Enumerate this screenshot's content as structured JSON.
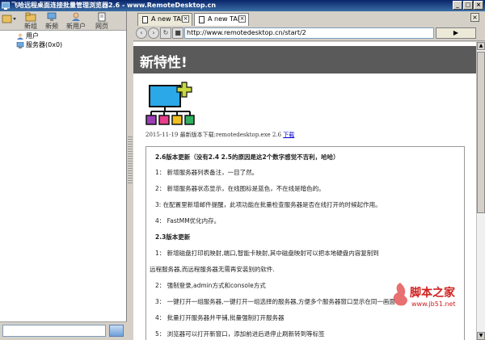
{
  "window": {
    "title": "飞哈远程桌面连接批量管理浏览器2.6 - www.RemoteDesktop.cn",
    "buttons": [
      "_",
      "□",
      "×"
    ]
  },
  "left_toolbar": [
    {
      "label": "新组",
      "icon": "new-group-icon"
    },
    {
      "label": "新频",
      "icon": "new-channel-icon"
    },
    {
      "label": "新用户",
      "icon": "new-user-icon"
    },
    {
      "label": "网页",
      "icon": "webpage-icon"
    }
  ],
  "tree": [
    {
      "label": "用户",
      "icon": "user-icon"
    },
    {
      "label": "服务器(0x0)",
      "icon": "server-icon"
    }
  ],
  "tabs": [
    {
      "label": "A new TAB",
      "close": "×"
    },
    {
      "label": "A new TAB",
      "close": "×"
    }
  ],
  "close_all": "×",
  "nav": {
    "address": "http://www.remotedesktop.cn/start/2",
    "back": "‹",
    "forward": "›",
    "refresh": "↻",
    "stop": "■",
    "go": "▶"
  },
  "page": {
    "title": "新特性!",
    "download_text": "2015-11-19 最新版本下载:remotedesktop.exe 2.6",
    "download_link": "下载",
    "notes": [
      {
        "text": "2.6版本更新（没有2.4 2.5的原因是这2个数字感觉不吉利，哈哈）",
        "bold": true
      },
      {
        "text": "1： 新增服务器列表备注，一目了然。",
        "bold": false
      },
      {
        "text": "2： 新增服务器状态显示，在线图标是蓝色，不在线是暗色的。",
        "bold": false
      },
      {
        "text": "3: 在配置里新增邮件提醒，此项功能在批量检查服务器是否在线打开的时候起作用。",
        "bold": false
      },
      {
        "text": "4： FastMM优化内存。",
        "bold": false
      },
      {
        "text": "2.3版本更新",
        "bold": true
      },
      {
        "text": "1： 新增磁盘打印机映射,端口,智能卡映射,其中磁盘映射可以把本地硬盘内容复制到",
        "bold": false
      },
      {
        "text": "远程服务器,而远程服务器无需再安装别的软件.",
        "bold": false
      },
      {
        "text": "2： 强制登录,admin方式和console方式",
        "bold": false
      },
      {
        "text": "3： 一键打开一组服务器,一键打开一组选择的服务器,方便多个服务器窗口显示在同一画面",
        "bold": false
      },
      {
        "text": "4： 批量打开服务器并平铺,批量强制打开服务器",
        "bold": false
      },
      {
        "text": "5： 浏览器可以打开新窗口，添加前进后退停止刷新转到等标签",
        "bold": false
      }
    ]
  },
  "watermark": {
    "brand": "脚本之家",
    "url": "www.jb51.net"
  }
}
